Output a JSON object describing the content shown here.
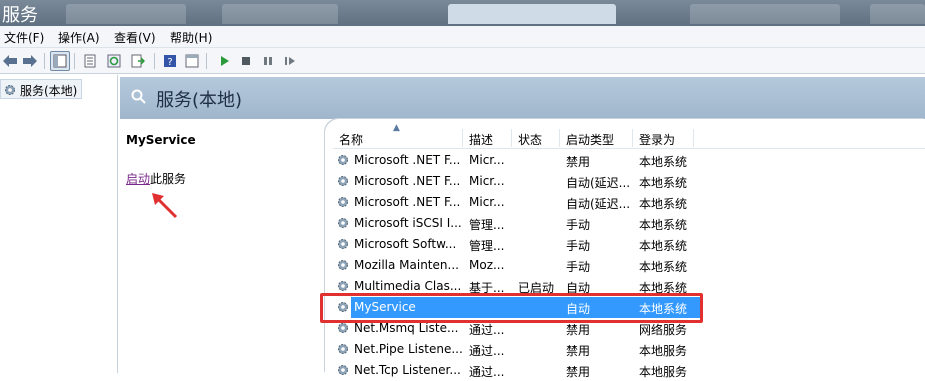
{
  "window": {
    "title": "服务",
    "tabs": [
      "",
      "",
      "",
      "",
      ""
    ]
  },
  "menu": {
    "items": [
      "文件(F)",
      "操作(A)",
      "查看(V)",
      "帮助(H)"
    ]
  },
  "tree": {
    "root_label": "服务(本地)"
  },
  "header": {
    "title": "服务(本地)"
  },
  "description": {
    "service_name": "MyService",
    "action_link": "启动",
    "action_suffix": "此服务"
  },
  "table": {
    "columns": [
      "名称",
      "描述",
      "状态",
      "启动类型",
      "登录为"
    ],
    "rows": [
      {
        "name": "Microsoft .NET F...",
        "desc": "Micr...",
        "status": "",
        "startup": "禁用",
        "logon": "本地系统"
      },
      {
        "name": "Microsoft .NET F...",
        "desc": "Micr...",
        "status": "",
        "startup": "自动(延迟...",
        "logon": "本地系统"
      },
      {
        "name": "Microsoft .NET F...",
        "desc": "Micr...",
        "status": "",
        "startup": "自动(延迟...",
        "logon": "本地系统"
      },
      {
        "name": "Microsoft iSCSI I...",
        "desc": "管理...",
        "status": "",
        "startup": "手动",
        "logon": "本地系统"
      },
      {
        "name": "Microsoft Softw...",
        "desc": "管理...",
        "status": "",
        "startup": "手动",
        "logon": "本地系统"
      },
      {
        "name": "Mozilla Mainten...",
        "desc": "Moz...",
        "status": "",
        "startup": "手动",
        "logon": "本地系统"
      },
      {
        "name": "Multimedia Clas...",
        "desc": "基于...",
        "status": "已启动",
        "startup": "自动",
        "logon": "本地系统"
      },
      {
        "name": "MyService",
        "desc": "",
        "status": "",
        "startup": "自动",
        "logon": "本地系统",
        "selected": true
      },
      {
        "name": "Net.Msmq Liste...",
        "desc": "通过...",
        "status": "",
        "startup": "禁用",
        "logon": "网络服务"
      },
      {
        "name": "Net.Pipe Listene...",
        "desc": "通过...",
        "status": "",
        "startup": "禁用",
        "logon": "本地服务"
      },
      {
        "name": "Net.Tcp Listener...",
        "desc": "通过...",
        "status": "",
        "startup": "禁用",
        "logon": "本地服务"
      }
    ]
  },
  "colors": {
    "selection": "#3399ff",
    "highlight_box": "#e03030",
    "link": "#7a2a8a",
    "header_band": "#b6c9dc"
  },
  "icons": {
    "service": "gear-icon",
    "play": "play-icon",
    "stop": "stop-icon",
    "pause": "pause-icon",
    "restart": "restart-icon"
  }
}
